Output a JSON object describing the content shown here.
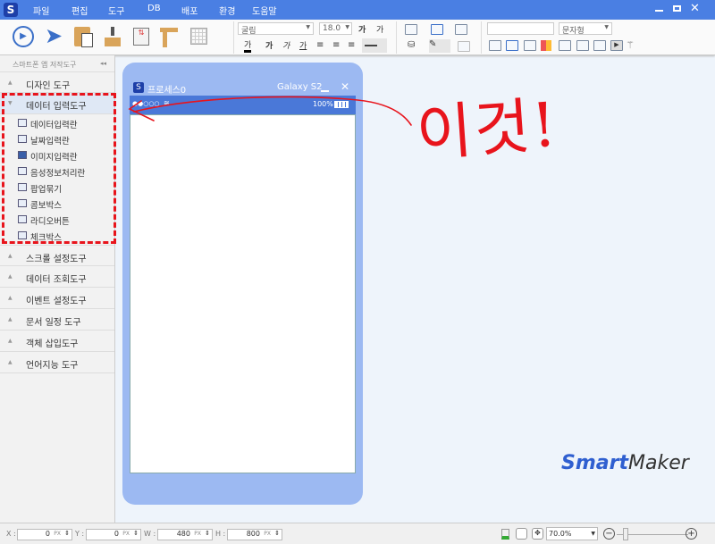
{
  "app": {
    "menu": [
      "파일",
      "편집",
      "도구",
      "DB",
      "배포",
      "환경",
      "도움말"
    ],
    "window_controls": [
      "minimize-icon",
      "maximize-icon",
      "close-icon"
    ]
  },
  "toolbar": {
    "font_family": "굴림",
    "font_size": "18.0",
    "text_type": "문자형",
    "text_input": "",
    "format_glyphs": [
      "가",
      "가",
      "가",
      "가",
      "가",
      "가"
    ]
  },
  "sidebar": {
    "title": "스마트폰 앱 저작도구",
    "collapse": "◂◂",
    "sections": [
      {
        "label": "디자인 도구"
      },
      {
        "label": "데이터 입력도구",
        "expanded": true
      },
      {
        "label": "스크롤 설정도구"
      },
      {
        "label": "데이터 조회도구"
      },
      {
        "label": "이벤트 설정도구"
      },
      {
        "label": "문서 일정 도구"
      },
      {
        "label": "객체 삽입도구"
      },
      {
        "label": "언어지능 도구"
      }
    ],
    "items": [
      "데이터입력란",
      "날짜입력란",
      "이미지입력란",
      "음성정보처리란",
      "팝업묶기",
      "콤보박스",
      "라디오버튼",
      "체크박스"
    ]
  },
  "phone": {
    "title": "프로세스0",
    "device": "Galaxy S2",
    "battery": "100%",
    "signal": "●●○○○"
  },
  "annotation": {
    "text": "이것!",
    "color": "#e8141c"
  },
  "logo": {
    "smart": "Smart",
    "maker": "Maker"
  },
  "status": {
    "x_label": "X :",
    "x": "0",
    "y_label": "Y :",
    "y": "0",
    "w_label": "W :",
    "w": "480",
    "h_label": "H :",
    "h": "800",
    "unit": "PX",
    "zoom": "70.0%",
    "zoom_level": 0.1
  }
}
